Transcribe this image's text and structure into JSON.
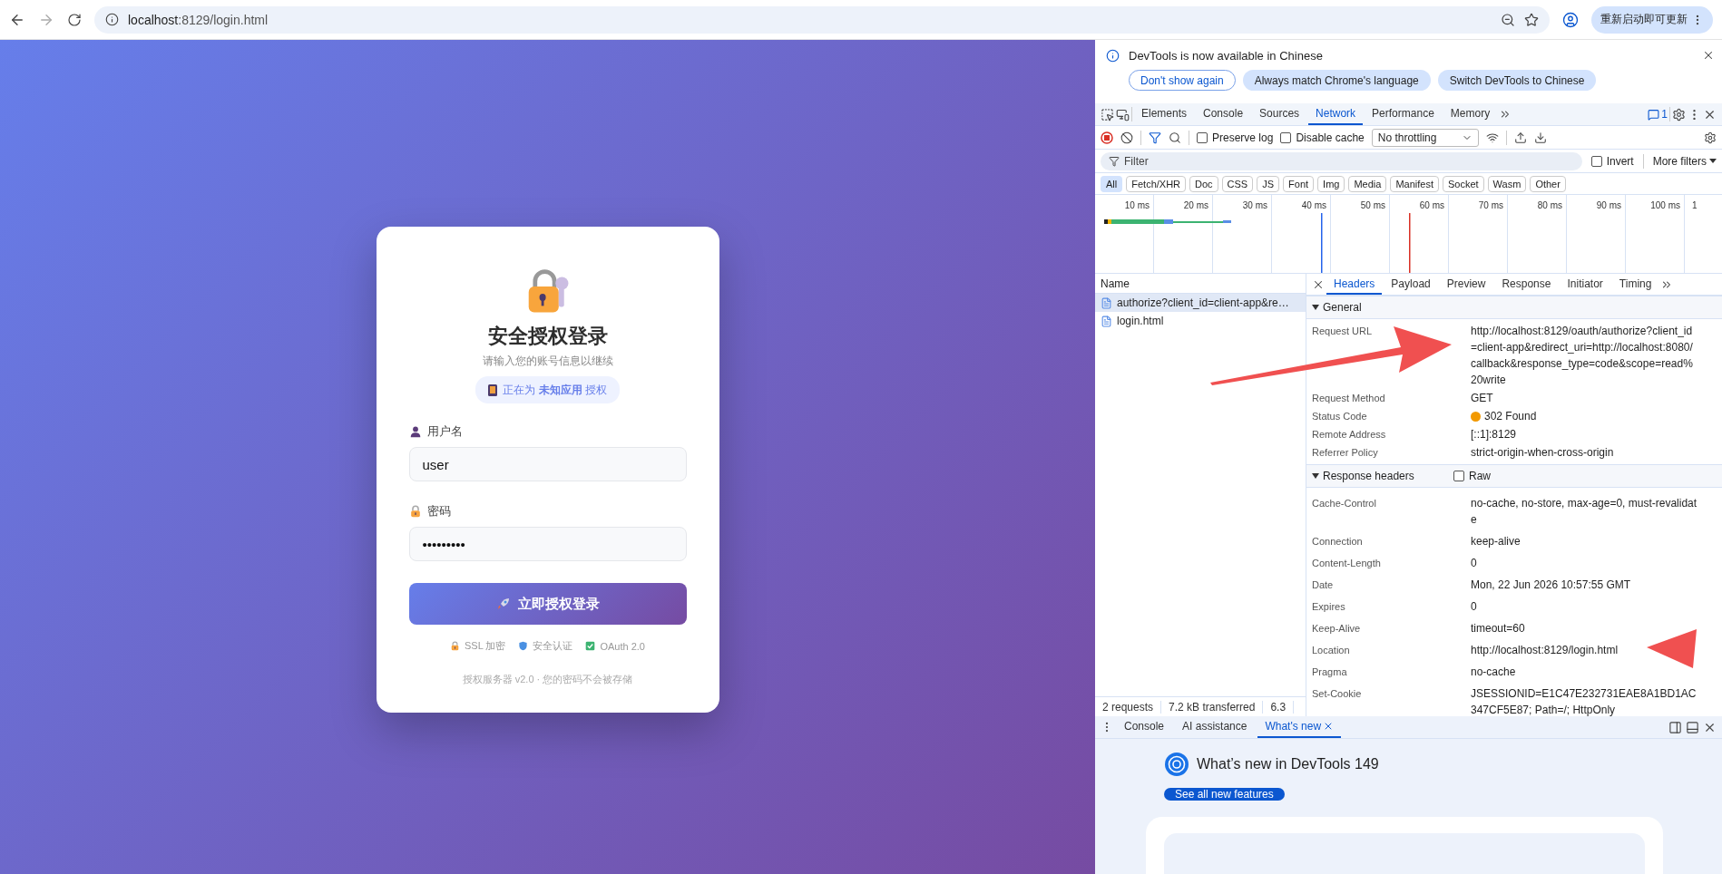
{
  "browser": {
    "host": "localhost",
    "path": ":8129/login.html",
    "update_button": "重新启动即可更新"
  },
  "login": {
    "title": "安全授权登录",
    "subtitle": "请输入您的账号信息以继续",
    "client_badge": "正在为 **未知应用** 授权",
    "fields": [
      {
        "kind": "user",
        "label": "用户名",
        "value": "user"
      },
      {
        "kind": "lock",
        "label": "密码",
        "value": "•••••••••"
      }
    ],
    "submit": "立即授权登录",
    "features": [
      {
        "kind": "lock",
        "label": "SSL 加密"
      },
      {
        "kind": "shield",
        "label": "安全认证"
      },
      {
        "kind": "check",
        "label": "OAuth 2.0"
      }
    ],
    "footer": "授权服务器 v2.0 · 您的密码不会被存储"
  },
  "devtools": {
    "infobar": {
      "message": "DevTools is now available in Chinese",
      "buttons": [
        {
          "kind": "outline",
          "label": "Don't show again"
        },
        {
          "kind": "tonal",
          "label": "Always match Chrome's language"
        },
        {
          "kind": "tonal",
          "label": "Switch DevTools to Chinese"
        }
      ]
    },
    "tabs": [
      {
        "label": "Elements",
        "selected": false
      },
      {
        "label": "Console",
        "selected": false
      },
      {
        "label": "Sources",
        "selected": false
      },
      {
        "label": "Network",
        "selected": true
      },
      {
        "label": "Performance",
        "selected": false
      },
      {
        "label": "Memory",
        "selected": false
      }
    ],
    "issues_count": "1",
    "toolbar": {
      "options": [
        {
          "label": "Preserve log",
          "checked": false
        },
        {
          "label": "Disable cache",
          "checked": false
        }
      ],
      "throttling": "No throttling"
    },
    "filter": {
      "placeholder": "Filter",
      "invert": {
        "label": "Invert",
        "checked": false
      },
      "more_filters": "More filters"
    },
    "type_filters": [
      {
        "label": "All",
        "selected": true
      },
      {
        "label": "Fetch/XHR",
        "selected": false
      },
      {
        "label": "Doc",
        "selected": false
      },
      {
        "label": "CSS",
        "selected": false
      },
      {
        "label": "JS",
        "selected": false
      },
      {
        "label": "Font",
        "selected": false
      },
      {
        "label": "Img",
        "selected": false
      },
      {
        "label": "Media",
        "selected": false
      },
      {
        "label": "Manifest",
        "selected": false
      },
      {
        "label": "Socket",
        "selected": false
      },
      {
        "label": "Wasm",
        "selected": false
      },
      {
        "label": "Other",
        "selected": false
      }
    ],
    "timeline_ticks": [
      "10 ms",
      "20 ms",
      "30 ms",
      "40 ms",
      "50 ms",
      "60 ms",
      "70 ms",
      "80 ms",
      "90 ms",
      "100 ms",
      "1"
    ],
    "name_header": "Name",
    "requests": [
      {
        "name": "authorize?client_id=client-app&re…",
        "selected": true
      },
      {
        "name": "login.html",
        "selected": false
      }
    ],
    "status_bar": [
      "2 requests",
      "7.2 kB transferred",
      "6.3"
    ],
    "detail_tabs": [
      {
        "label": "Headers",
        "selected": true
      },
      {
        "label": "Payload",
        "selected": false
      },
      {
        "label": "Preview",
        "selected": false
      },
      {
        "label": "Response",
        "selected": false
      },
      {
        "label": "Initiator",
        "selected": false
      },
      {
        "label": "Timing",
        "selected": false
      }
    ],
    "sections": [
      {
        "title": "General",
        "expanded": true,
        "rows": [
          {
            "name": "Request URL",
            "value": "http://localhost:8129/oauth/authorize?client_id=client-app&redirect_uri=http://localhost:8080/callback&response_type=code&scope=read%20write"
          },
          {
            "name": "Request Method",
            "value": "GET"
          },
          {
            "name": "Status Code",
            "value": "302 Found",
            "color": "#f29900"
          },
          {
            "name": "Remote Address",
            "value": "[::1]:8129"
          },
          {
            "name": "Referrer Policy",
            "value": "strict-origin-when-cross-origin"
          }
        ]
      },
      {
        "title": "Response headers",
        "expanded": true,
        "raw": {
          "label": "Raw",
          "checked": false
        },
        "rows": [
          {
            "name": "Cache-Control",
            "value": "no-cache, no-store, max-age=0, must-revalidate"
          },
          {
            "name": "Connection",
            "value": "keep-alive"
          },
          {
            "name": "Content-Length",
            "value": "0"
          },
          {
            "name": "Date",
            "value": "Mon, 22 Jun 2026 10:57:55 GMT"
          },
          {
            "name": "Expires",
            "value": "0"
          },
          {
            "name": "Keep-Alive",
            "value": "timeout=60"
          },
          {
            "name": "Location",
            "value": "http://localhost:8129/login.html"
          },
          {
            "name": "Pragma",
            "value": "no-cache"
          },
          {
            "name": "Set-Cookie",
            "value": "JSESSIONID=E1C47E232731EAE8A1BD1AC347CF5E87; Path=/; HttpOnly"
          }
        ]
      }
    ],
    "drawer": {
      "tabs": [
        {
          "label": "Console",
          "selected": false,
          "closable": false
        },
        {
          "label": "AI assistance",
          "selected": false,
          "closable": false
        },
        {
          "label": "What's new",
          "selected": true,
          "closable": true
        }
      ],
      "title": "What’s new in DevTools 149",
      "button": "See all new features"
    }
  }
}
